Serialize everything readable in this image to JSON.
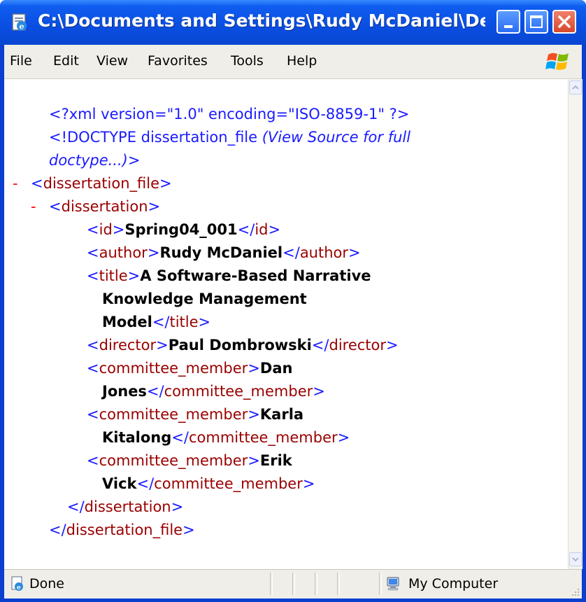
{
  "window": {
    "title": "C:\\Documents and Settings\\Rudy McDaniel\\Deskt..."
  },
  "menu": {
    "items": [
      "File",
      "Edit",
      "View",
      "Favorites",
      "Tools",
      "Help"
    ]
  },
  "xml": {
    "pi": "<?xml version=\"1.0\" encoding=\"ISO-8859-1\" ?>",
    "doctype_open": "<!DOCTYPE dissertation_file ",
    "doctype_note_1": "(View Source for full",
    "doctype_note_2": "doctype...)",
    "doctype_close": ">",
    "minus": "-",
    "lt": "<",
    "gt": ">",
    "lt_slash": "</",
    "root_tag": "dissertation_file",
    "dissertation_tag": "dissertation",
    "id_tag": "id",
    "id_value": "Spring04_001",
    "author_tag": "author",
    "author_value": "Rudy McDaniel",
    "title_tag": "title",
    "title_value_1": "A Software-Based Narrative",
    "title_value_2": "Knowledge Management",
    "title_value_3": "Model",
    "director_tag": "director",
    "director_value": "Paul Dombrowski",
    "committee_tag": "committee_member",
    "committee": [
      {
        "first": "Dan",
        "last": "Jones"
      },
      {
        "first": "Karla",
        "last": "Kitalong"
      },
      {
        "first": "Erik",
        "last": "Vick"
      }
    ]
  },
  "status": {
    "text": "Done",
    "zone": "My Computer"
  },
  "colors": {
    "titlebar": "#0a4ee0",
    "tag_bracket": "#1a1aff",
    "tag_name": "#990000",
    "collapse_minus": "#ff0000"
  }
}
